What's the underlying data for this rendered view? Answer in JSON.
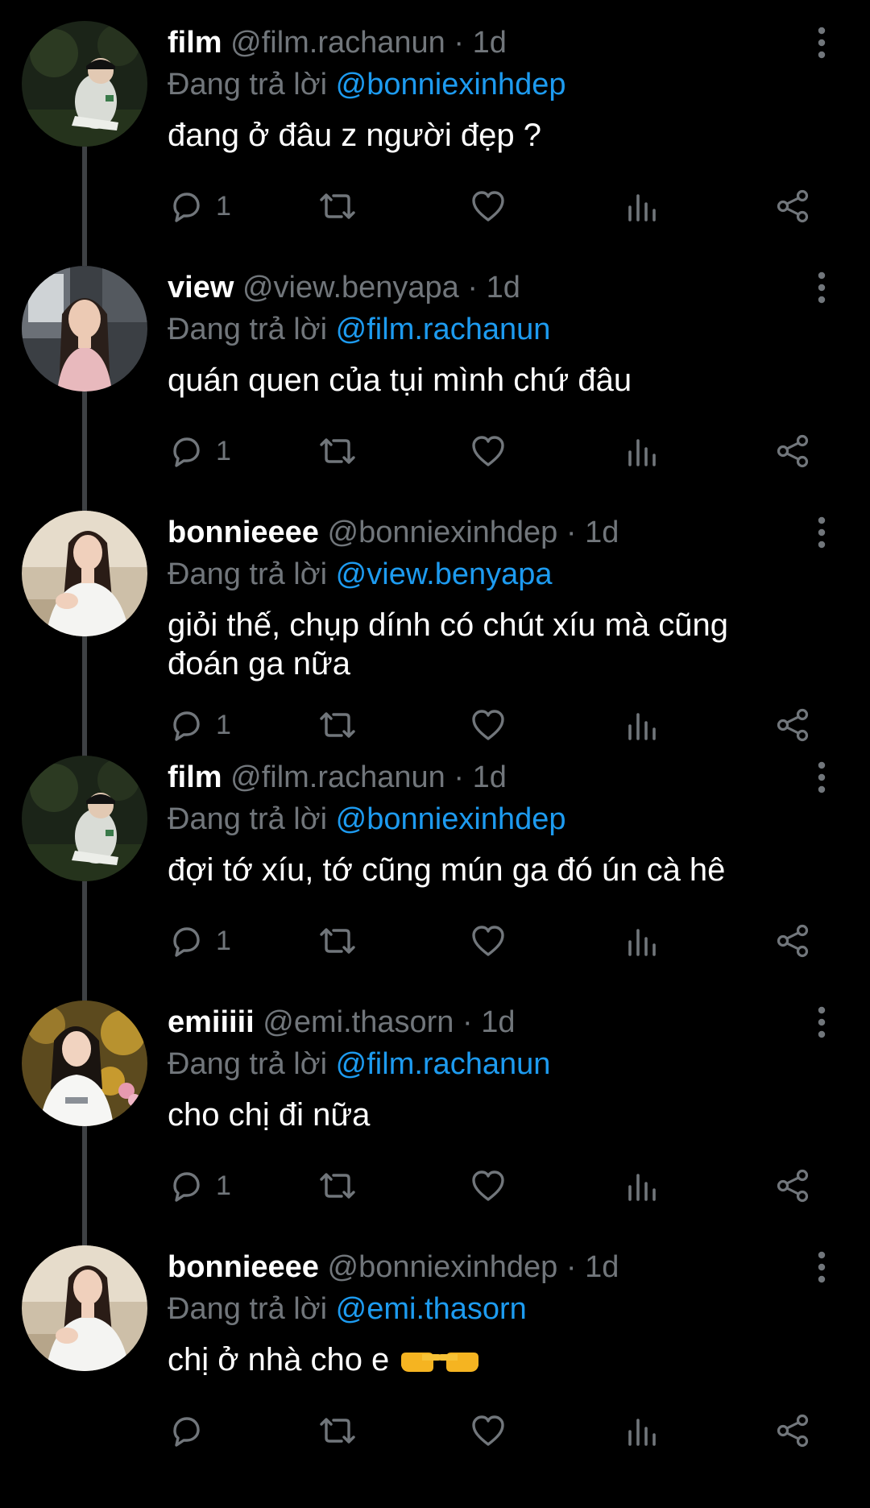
{
  "reply_prefix": "Đang trả lời",
  "icons": {
    "reply": "reply-icon",
    "retweet": "retweet-icon",
    "like": "heart-icon",
    "views": "views-icon",
    "share": "share-icon",
    "more": "more-vertical-icon"
  },
  "colors": {
    "background": "#000000",
    "text": "#ffffff",
    "secondary": "#71767b",
    "accent": "#1d9bf0",
    "thread_line": "#3e4144"
  },
  "tweets": [
    {
      "display_name": "film",
      "handle": "@film.rachanun",
      "separator": "·",
      "time": "1d",
      "reply_to": "@bonniexinhdep",
      "text": "đang ở đâu z người đẹp ?",
      "reply_count": "1"
    },
    {
      "display_name": "view",
      "handle": "@view.benyapa",
      "separator": "·",
      "time": "1d",
      "reply_to": "@film.rachanun",
      "text": "quán quen của tụi mình chứ đâu",
      "reply_count": "1"
    },
    {
      "display_name": "bonnieeee",
      "handle": "@bonniexinhdep",
      "separator": "·",
      "time": "1d",
      "reply_to": "@view.benyapa",
      "text": "giỏi thế, chụp dính có chút xíu mà cũng đoán ga nữa",
      "reply_count": "1"
    },
    {
      "display_name": "film",
      "handle": "@film.rachanun",
      "separator": "·",
      "time": "1d",
      "reply_to": "@bonniexinhdep",
      "text": "đợi tớ xíu, tớ cũng mún ga đó ún cà hê",
      "reply_count": "1"
    },
    {
      "display_name": "emiiiii",
      "handle": "@emi.thasorn",
      "separator": "·",
      "time": "1d",
      "reply_to": "@film.rachanun",
      "text": "cho chị đi nữa",
      "reply_count": "1"
    },
    {
      "display_name": "bonnieeee",
      "handle": "@bonniexinhdep",
      "separator": "·",
      "time": "1d",
      "reply_to": "@emi.thasorn",
      "text": "chị ở nhà cho e",
      "text_emoji": "👉👈",
      "reply_count": ""
    }
  ]
}
